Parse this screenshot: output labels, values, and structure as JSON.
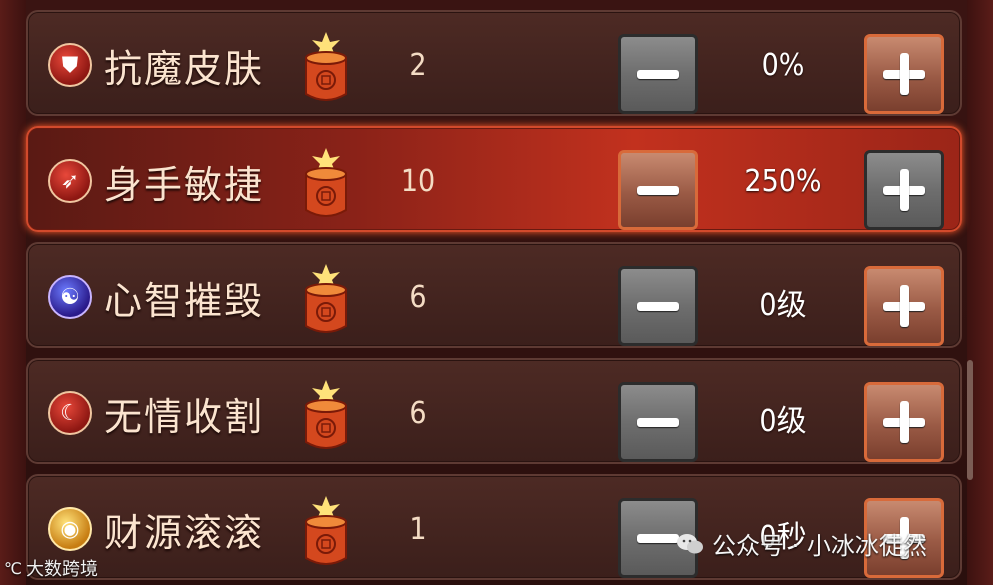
{
  "skills": [
    {
      "name": "抗魔皮肤",
      "cost": "2",
      "value": "0%",
      "icon": "shield-icon"
    },
    {
      "name": "身手敏捷",
      "cost": "10",
      "value": "250%",
      "icon": "boot-icon"
    },
    {
      "name": "心智摧毁",
      "cost": "6",
      "value": "0级",
      "icon": "brain-icon"
    },
    {
      "name": "无情收割",
      "cost": "6",
      "value": "0级",
      "icon": "scythe-icon"
    },
    {
      "name": "财源滚滚",
      "cost": "1",
      "value": "0秒",
      "icon": "gold-ingot-icon"
    }
  ],
  "selected_index": 1,
  "watermark_left": "大数跨境",
  "watermark_right": "公众号 · 小冰冰徒然",
  "colors": {
    "row_bg": "#4d2a24",
    "selected_bg": "#c2311e",
    "plus_button": "#9a5a45",
    "minus_button": "#6e6e6e",
    "text": "#fbe4cf"
  }
}
